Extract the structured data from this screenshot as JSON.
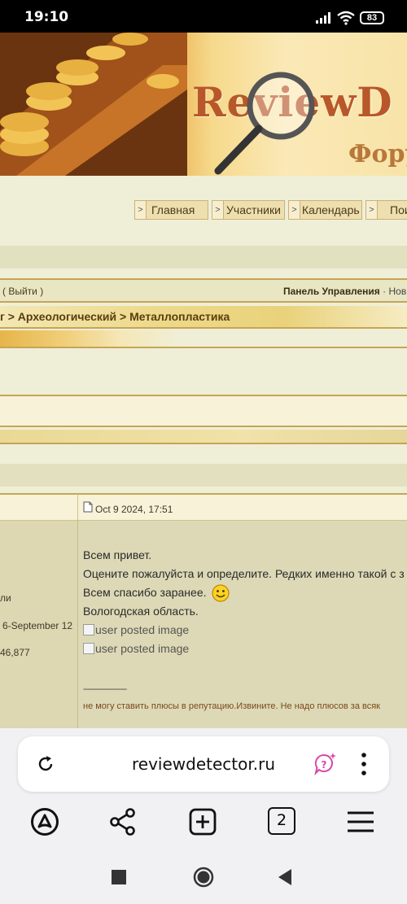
{
  "status_bar": {
    "time": "19:10",
    "signal_icon": "signal-icon",
    "wifi_icon": "wifi-icon",
    "battery": "83"
  },
  "banner": {
    "logo_text": "ReviewD",
    "subtitle": "Фору"
  },
  "nav": {
    "items": [
      {
        "label": "Главная"
      },
      {
        "label": "Участники"
      },
      {
        "label": "Календарь"
      },
      {
        "label": "Пои"
      }
    ]
  },
  "userbar": {
    "logout": "( Выйти )",
    "panel": "Панель Управления",
    "new": " · Новы"
  },
  "breadcrumb": {
    "text": "г > Археологический > Металлопластика"
  },
  "post": {
    "date": "Oct 9 2024, 17:51",
    "author_info": {
      "line1": "ли",
      "line2": "6-September 12",
      "line3": "46,877"
    },
    "body_lines": [
      "Всем привет.",
      "Оцените пожалуйста и определите. Редких именно такой с з",
      "Всем спасибо заранее.",
      "Вологодская область."
    ],
    "images": [
      "user posted image",
      "user posted image"
    ],
    "signature_sep": "--------------------",
    "signature": "не могу ставить плюсы в репутацию.Извините. Не надо плюсов за всяк"
  },
  "browser": {
    "url": "reviewdetector.ru",
    "tabs_count": "2"
  },
  "colors": {
    "accent_gold": "#c7a455",
    "page_bg": "#efefd8",
    "post_bg": "#ddd9b6"
  }
}
